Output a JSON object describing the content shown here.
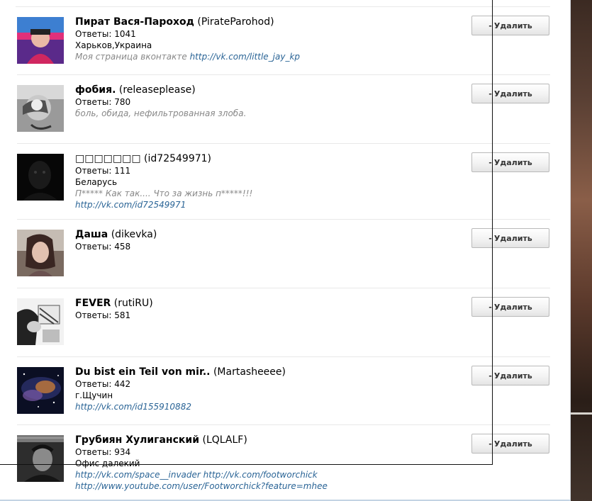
{
  "users": [
    {
      "name": "Пират Вася-Пароход",
      "login": "(PirateParohod)",
      "answers": "Ответы: 1041",
      "city": "Харьков,Украина",
      "note": "Моя страница вконтакте",
      "links": [
        "http://vk.com/little_jay_kp"
      ],
      "button": "Удалить"
    },
    {
      "name": "фобия.",
      "login": "(releaseplease)",
      "answers": "Ответы: 780",
      "city": "",
      "note": "боль, обида, нефильтрованная злоба.",
      "links": [],
      "button": "Удалить"
    },
    {
      "name": "□□□□□□□",
      "login": "(id72549971)",
      "answers": "Ответы: 111",
      "city": "Беларусь",
      "note": "П***** Как так.... Что за жизнь п*****!!!",
      "links": [
        "http://vk.com/id72549971"
      ],
      "button": "Удалить"
    },
    {
      "name": "Даша",
      "login": "(dikevka)",
      "answers": "Ответы: 458",
      "city": "",
      "note": "",
      "links": [],
      "button": "Удалить"
    },
    {
      "name": "FEVER",
      "login": "(rutiRU)",
      "answers": "Ответы: 581",
      "city": "",
      "note": "",
      "links": [],
      "button": "Удалить"
    },
    {
      "name": "Du bist ein Teil von mir..",
      "login": "(Martasheeee)",
      "answers": "Ответы: 442",
      "city": "г.Щучин",
      "note": "",
      "links": [
        "http://vk.com/id155910882"
      ],
      "button": "Удалить"
    },
    {
      "name": "Грубиян Хулиганский",
      "login": "(LQLALF)",
      "answers": "Ответы: 934",
      "city": "Офис далекий",
      "note": "",
      "links": [
        "http://vk.com/space__invader http://vk.com/footworchick",
        "http://www.youtube.com/user/Footworchick?feature=mhee"
      ],
      "button": "Удалить"
    }
  ]
}
